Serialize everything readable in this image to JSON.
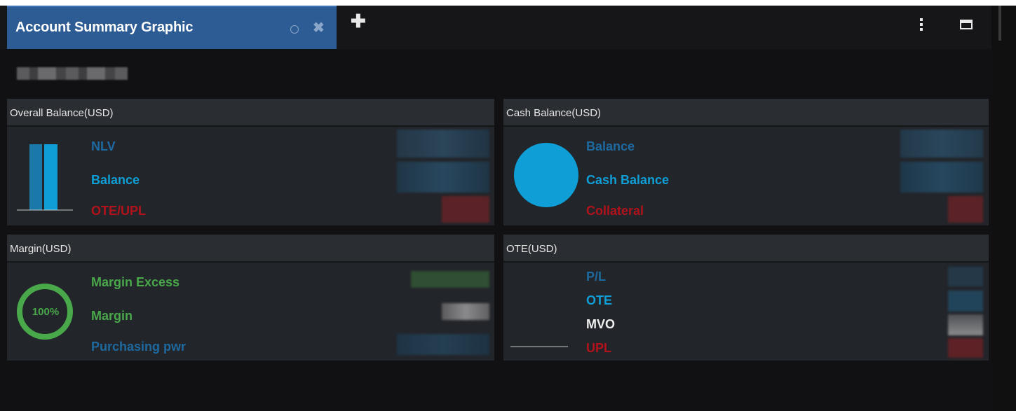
{
  "tab": {
    "title": "Account Summary Graphic"
  },
  "icons": {
    "tab_status": "circle-icon",
    "tab_close": "close-icon",
    "add_tab": "plus-icon",
    "more": "kebab-icon",
    "maximize": "maximize-icon"
  },
  "glyphs": {
    "close": "✖",
    "add": "✚"
  },
  "panels": {
    "overall": {
      "title": "Overall Balance(USD)",
      "items": [
        "NLV",
        "Balance",
        "OTE/UPL"
      ]
    },
    "cash": {
      "title": "Cash Balance(USD)",
      "items": [
        "Balance",
        "Cash Balance",
        "Collateral"
      ]
    },
    "margin": {
      "title": "Margin(USD)",
      "gauge_label": "100%",
      "items": [
        "Margin Excess",
        "Margin",
        "Purchasing pwr"
      ]
    },
    "ote": {
      "title": "OTE(USD)",
      "items": [
        "P/L",
        "OTE",
        "MVO",
        "UPL"
      ]
    }
  },
  "colors": {
    "tab_bg": "#2d5b94",
    "blue": "#0f9fd6",
    "dark_blue": "#1e6aa0",
    "red": "#b3121b",
    "green": "#49a84a"
  }
}
